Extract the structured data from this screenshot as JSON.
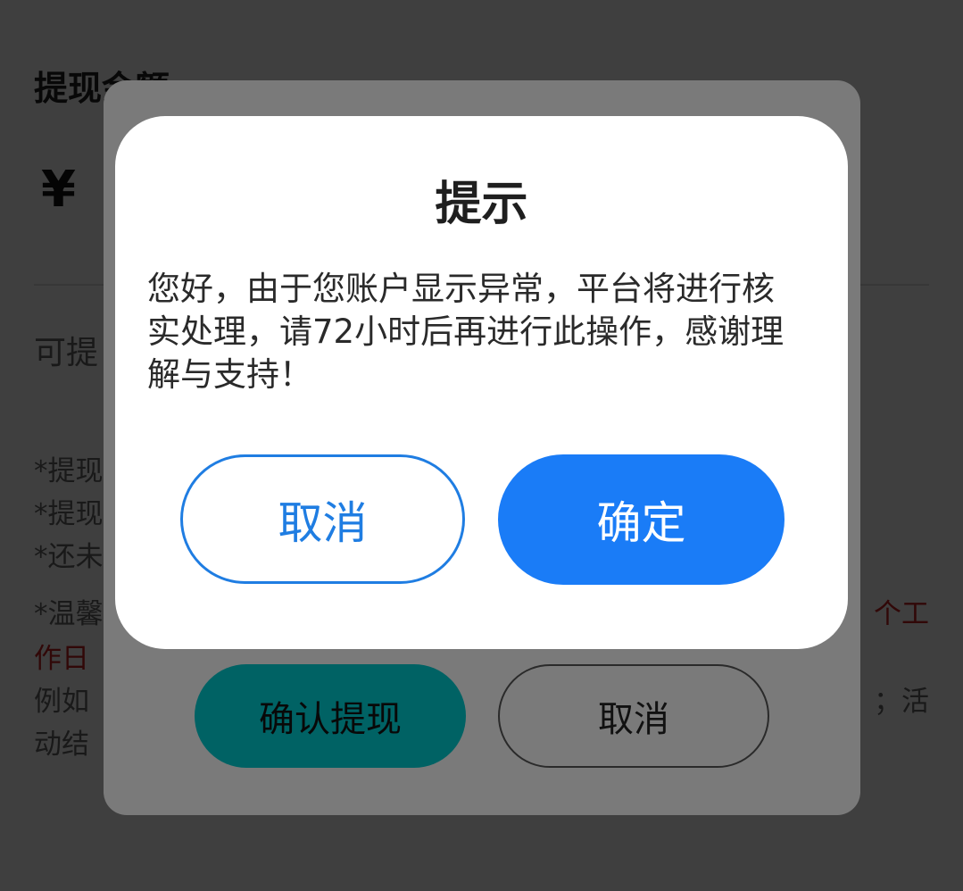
{
  "page": {
    "title": "提现金额",
    "currency_symbol": "¥",
    "available_label": "可提",
    "notes": [
      "*提现",
      "*提现",
      "*还未",
      "*温馨"
    ],
    "notes_right": "个工",
    "red_line": "作日",
    "gray_line_start": "例如",
    "gray_line_end": "；活",
    "gray_line_2": "动结"
  },
  "sheet": {
    "confirm_label": "确认提现",
    "cancel_label": "取消"
  },
  "dialog": {
    "title": "提示",
    "message": "您好，由于您账户显示异常，平台将进行核实处理，请72小时后再进行此操作，感谢理解与支持！",
    "cancel_label": "取消",
    "ok_label": "确定"
  },
  "colors": {
    "dialog_primary": "#1a7cf7",
    "dialog_cancel_border": "#1f7de2",
    "sheet_confirm": "#00c4c8",
    "warning_red": "#c62020"
  }
}
